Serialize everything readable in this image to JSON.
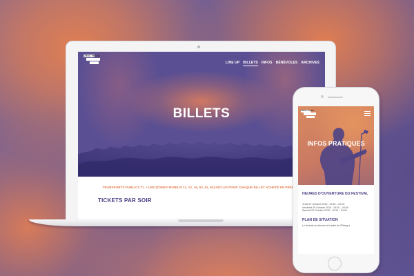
{
  "site": {
    "logo_text": "CROC' ROCK",
    "nav": [
      "LINE UP",
      "BILLETS",
      "INFOS",
      "BÉNÉVOLES",
      "ARCHIVES"
    ],
    "active_nav": "BILLETS"
  },
  "desktop": {
    "hero_title": "BILLETS",
    "transport_note": "TRANSPORTS PUBLICS TL + LEB (ZONES MOBILIS 11, 12, 16, 50, 51, 52) INCLUS POUR CHAQUE BILLET ACHETÉ EN PRÉLOC'!",
    "section_heading": "TICKETS PAR SOIR"
  },
  "mobile": {
    "hero_title": "INFOS PRATIQUES",
    "opening_heading": "HEURES D'OUVERTURE DU FESTIVAL",
    "opening_hours": [
      "Jeudi 27 Octobre 2016 : 19:30 – 02:00",
      "Vendredi 28 Octobre 2016 : 19:30 – 04:00",
      "Samedi 29 Octobre 2016 : 19:30 – 04:00"
    ],
    "situation_heading": "PLAN DE SITUATION",
    "situation_text": "Le festival se déroule à la salle de l'Étang à"
  },
  "colors": {
    "brand_purple": "#4b3f84",
    "brand_orange": "#e17d4e",
    "hero_purple": "#5a4f93"
  },
  "icons": {
    "menu": "hamburger-menu-icon"
  }
}
